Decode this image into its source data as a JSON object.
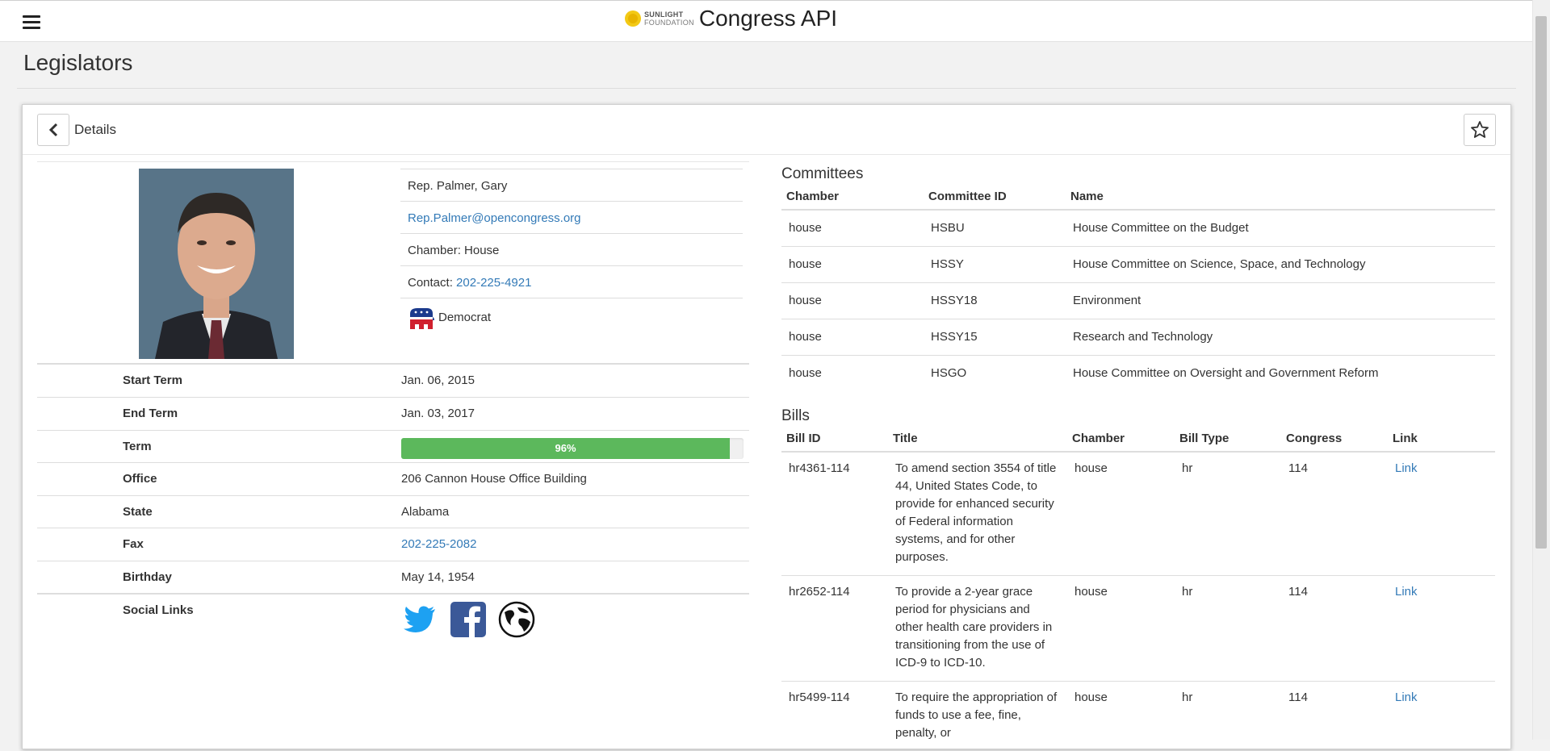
{
  "header": {
    "logo_line1": "SUNLIGHT",
    "logo_line2": "FOUNDATION",
    "app_title": "Congress API"
  },
  "page": {
    "title": "Legislators"
  },
  "panel": {
    "title": "Details"
  },
  "legislator": {
    "name": "Rep. Palmer, Gary",
    "email": "Rep.Palmer@opencongress.org",
    "chamber": "Chamber: House",
    "contact_label": "Contact:",
    "contact_phone": "202-225-4921",
    "party": "Democrat"
  },
  "details": [
    {
      "key": "Start Term",
      "value": "Jan. 06, 2015"
    },
    {
      "key": "End Term",
      "value": "Jan. 03, 2017"
    },
    {
      "key": "Term",
      "value": "96%",
      "progress": 0.96
    },
    {
      "key": "Office",
      "value": "206 Cannon House Office Building"
    },
    {
      "key": "State",
      "value": "Alabama"
    },
    {
      "key": "Fax",
      "value": "202-225-2082"
    },
    {
      "key": "Birthday",
      "value": "May 14, 1954"
    },
    {
      "key": "Social Links",
      "icons": [
        "twitter-icon",
        "facebook-icon",
        "globe-icon"
      ]
    }
  ],
  "committees": {
    "title": "Committees",
    "columns": [
      "Chamber",
      "Committee ID",
      "Name"
    ],
    "rows": [
      [
        "house",
        "HSBU",
        "House Committee on the Budget"
      ],
      [
        "house",
        "HSSY",
        "House Committee on Science, Space, and Technology"
      ],
      [
        "house",
        "HSSY18",
        "Environment"
      ],
      [
        "house",
        "HSSY15",
        "Research and Technology"
      ],
      [
        "house",
        "HSGO",
        "House Committee on Oversight and Government Reform"
      ]
    ]
  },
  "bills": {
    "title": "Bills",
    "columns": [
      "Bill ID",
      "Title",
      "Chamber",
      "Bill Type",
      "Congress",
      "Link"
    ],
    "rows": [
      [
        "hr4361-114",
        "To amend section 3554 of title 44, United States Code, to provide for enhanced security of Federal information systems, and for other purposes.",
        "house",
        "hr",
        "114",
        "Link"
      ],
      [
        "hr2652-114",
        "To provide a 2-year grace period for physicians and other health care providers in transitioning from the use of ICD-9 to ICD-10.",
        "house",
        "hr",
        "114",
        "Link"
      ],
      [
        "hr5499-114",
        "To require the appropriation of funds to use a fee, fine, penalty, or",
        "house",
        "hr",
        "114",
        "Link"
      ]
    ]
  },
  "colors": {
    "accent_link": "#337ab7",
    "progress": "#5cb85c",
    "twitter": "#1da1f2",
    "facebook": "#3b5998"
  }
}
